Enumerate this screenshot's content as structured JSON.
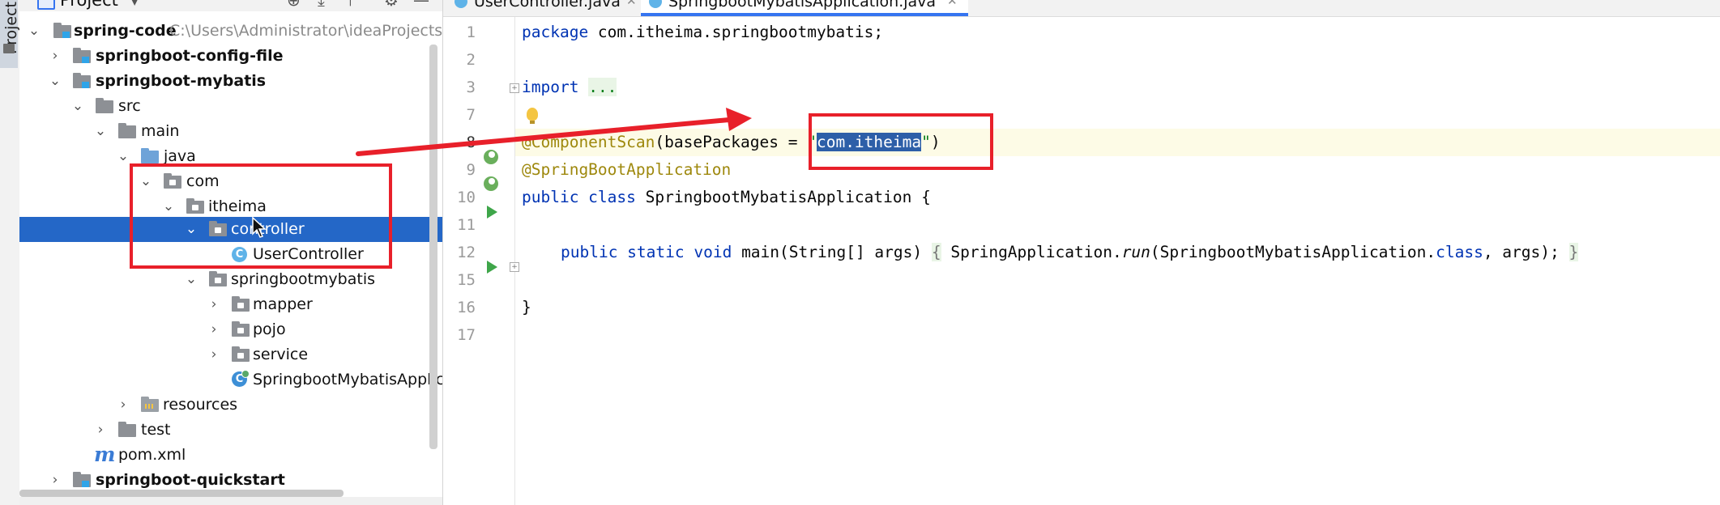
{
  "sidebar_strip": {
    "tab_label": "Project"
  },
  "project_panel": {
    "title": "Project",
    "tree": [
      {
        "label": "spring-code",
        "path": "C:\\Users\\Administrator\\ideaProjects\\s",
        "bold": true
      },
      {
        "label": "springboot-config-file",
        "bold": true
      },
      {
        "label": "springboot-mybatis",
        "bold": true
      },
      {
        "label": "src"
      },
      {
        "label": "main"
      },
      {
        "label": "java"
      },
      {
        "label": "com"
      },
      {
        "label": "itheima"
      },
      {
        "label": "controller"
      },
      {
        "label": "UserController"
      },
      {
        "label": "springbootmybatis"
      },
      {
        "label": "mapper"
      },
      {
        "label": "pojo"
      },
      {
        "label": "service"
      },
      {
        "label": "SpringbootMybatisApplic"
      },
      {
        "label": "resources"
      },
      {
        "label": "test"
      },
      {
        "label": "pom.xml"
      },
      {
        "label": "springboot-quickstart",
        "bold": true
      }
    ]
  },
  "editor": {
    "tabs": [
      {
        "label": "UserController.java",
        "active": false
      },
      {
        "label": "SpringbootMybatisApplication.java",
        "active": true
      }
    ],
    "line_numbers": [
      "1",
      "2",
      "3",
      "7",
      "8",
      "9",
      "10",
      "11",
      "12",
      "15",
      "16",
      "17"
    ],
    "code": {
      "l1_kw": "package",
      "l1_rest": " com.itheima.springbootmybatis;",
      "l3_kw": "import",
      "l3_fold": "...",
      "l8_ann": "@ComponentScan",
      "l8_mid": "(basePackages = ",
      "l8_q1": "\"",
      "l8_sel": "com.itheima",
      "l8_q2": "\"",
      "l8_end": ")",
      "l9_ann": "@SpringBootApplication",
      "l10_kw": "public class",
      "l10_rest": " SpringbootMybatisApplication {",
      "l12_kw": "public static void",
      "l12_mid": " main(String[] args) ",
      "l12_ob": "{",
      "l12_call1": " SpringApplication.",
      "l12_run": "run",
      "l12_call2": "(SpringbootMybatisApplication.",
      "l12_classkw": "class",
      "l12_call3": ", args); ",
      "l12_cb": "}",
      "l16_brace": "}"
    }
  },
  "colors": {
    "keyword": "#0033b3",
    "annotation": "#9e880d",
    "string": "#067d17",
    "selection": "#2d5fa8",
    "tree_selection": "#2467c7",
    "annotation_red": "#e8202a"
  }
}
